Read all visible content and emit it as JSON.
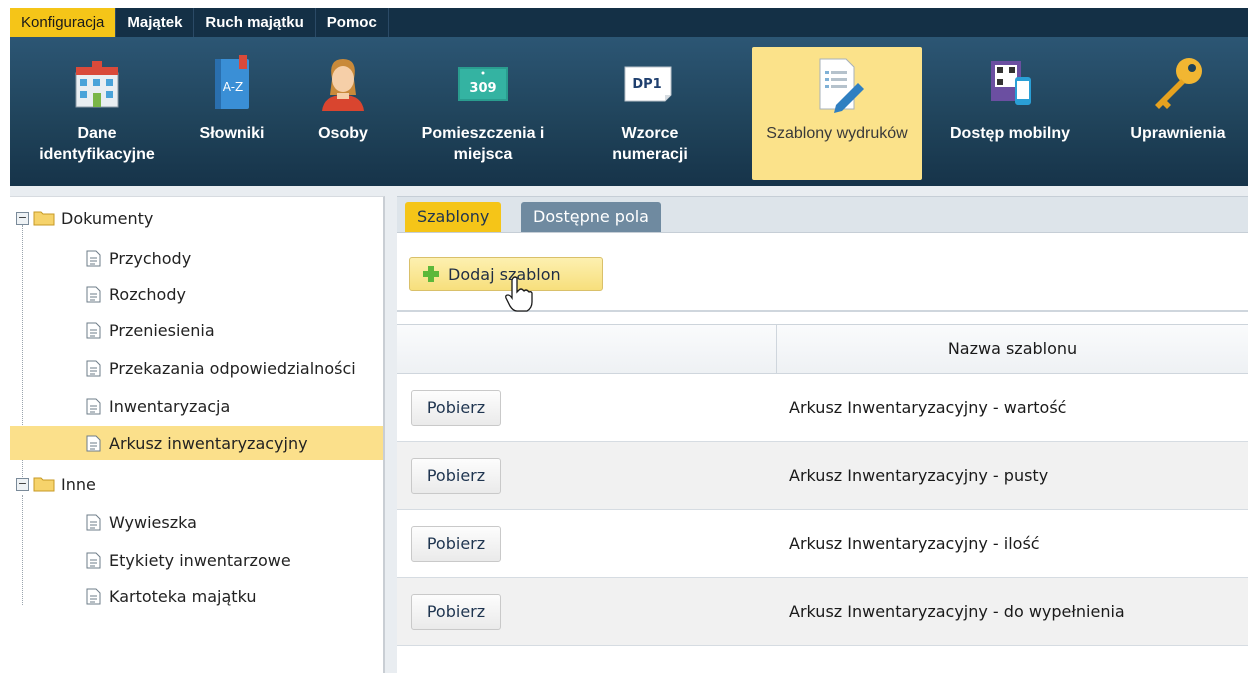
{
  "menu": {
    "items": [
      {
        "label": "Konfiguracja",
        "active": true
      },
      {
        "label": "Majątek",
        "active": false
      },
      {
        "label": "Ruch majątku",
        "active": false
      },
      {
        "label": "Pomoc",
        "active": false
      }
    ]
  },
  "toolbar": {
    "items": [
      {
        "label": "Dane identyfikacyjne",
        "icon": "building-icon"
      },
      {
        "label": "Słowniki",
        "icon": "dictionary-icon",
        "badge": "A-Z"
      },
      {
        "label": "Osoby",
        "icon": "person-icon"
      },
      {
        "label": "Pomieszczenia i miejsca",
        "icon": "room-number-icon",
        "badge": "309"
      },
      {
        "label": "Wzorce numeracji",
        "icon": "numbering-pattern-icon",
        "badge": "DP1"
      },
      {
        "label": "Szablony wydruków",
        "icon": "print-template-icon",
        "active": true
      },
      {
        "label": "Dostęp mobilny",
        "icon": "mobile-access-icon"
      },
      {
        "label": "Uprawnienia",
        "icon": "key-icon"
      }
    ]
  },
  "tree": {
    "groups": [
      {
        "label": "Dokumenty",
        "items": [
          "Przychody",
          "Rozchody",
          "Przeniesienia",
          "Przekazania odpowiedzialności",
          "Inwentaryzacja",
          "Arkusz inwentaryzacyjny"
        ]
      },
      {
        "label": "Inne",
        "items": [
          "Wywieszka",
          "Etykiety inwentarzowe",
          "Kartoteka majątku"
        ]
      }
    ],
    "selected": "Arkusz inwentaryzacyjny"
  },
  "tabs": {
    "active": "Szablony",
    "inactive": "Dostępne pola"
  },
  "actions": {
    "add_label": "Dodaj szablon"
  },
  "grid": {
    "header_name": "Nazwa szablonu",
    "download_label": "Pobierz",
    "rows": [
      "Arkusz Inwentaryzacyjny - wartość",
      "Arkusz Inwentaryzacyjny - pusty",
      "Arkusz Inwentaryzacyjny - ilość",
      "Arkusz Inwentaryzacyjny - do wypełnienia"
    ]
  },
  "colors": {
    "menu_bg": "#143046",
    "accent": "#f5c518",
    "selection": "#fbe08b"
  }
}
